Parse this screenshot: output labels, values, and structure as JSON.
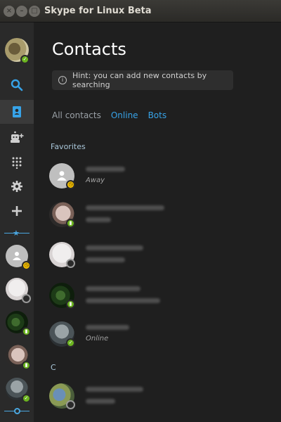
{
  "window": {
    "title": "Skype for Linux Beta",
    "close_glyph": "×",
    "min_glyph": "–",
    "max_glyph": "□"
  },
  "sidebar": {
    "items": [
      {
        "icon": "search-icon"
      },
      {
        "icon": "contacts-icon",
        "active": true
      },
      {
        "icon": "add-bot-icon"
      },
      {
        "icon": "dialpad-icon"
      },
      {
        "icon": "settings-icon"
      },
      {
        "icon": "add-icon"
      }
    ],
    "favorites_star": "★"
  },
  "main": {
    "title": "Contacts",
    "hint": {
      "icon_glyph": "i",
      "text": "Hint: you can add new contacts by searching"
    },
    "tabs": [
      {
        "label": "All contacts",
        "active": false
      },
      {
        "label": "Online",
        "active": true
      },
      {
        "label": "Bots",
        "active": true
      }
    ],
    "sections": [
      {
        "label": "Favorites"
      },
      {
        "label": "C"
      }
    ],
    "contacts": [
      {
        "status": "away",
        "sub": "Away"
      },
      {
        "status": "online",
        "sub": ""
      },
      {
        "status": "offline",
        "sub": ""
      },
      {
        "status": "online",
        "sub": ""
      },
      {
        "status": "online",
        "sub": "Online"
      },
      {
        "status": "offline",
        "sub": ""
      }
    ]
  },
  "colors": {
    "accent": "#37a3e8",
    "online": "#6cb420",
    "away": "#f8c200"
  }
}
